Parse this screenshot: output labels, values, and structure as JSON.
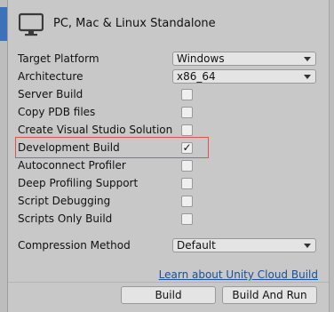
{
  "header": {
    "title": "PC, Mac & Linux Standalone",
    "icon": "monitor-icon"
  },
  "settings": {
    "target_platform": {
      "label": "Target Platform",
      "value": "Windows"
    },
    "architecture": {
      "label": "Architecture",
      "value": "x86_64"
    },
    "server_build": {
      "label": "Server Build",
      "checked": false
    },
    "copy_pdb": {
      "label": "Copy PDB files",
      "checked": false
    },
    "create_vs_solution": {
      "label": "Create Visual Studio Solution",
      "checked": false
    },
    "development_build": {
      "label": "Development Build",
      "checked": true,
      "check_glyph": "✓"
    },
    "autoconnect_profiler": {
      "label": "Autoconnect Profiler",
      "checked": false
    },
    "deep_profiling": {
      "label": "Deep Profiling Support",
      "checked": false
    },
    "script_debugging": {
      "label": "Script Debugging",
      "checked": false
    },
    "scripts_only": {
      "label": "Scripts Only Build",
      "checked": false
    },
    "compression_method": {
      "label": "Compression Method",
      "value": "Default"
    }
  },
  "link": {
    "text": "Learn about Unity Cloud Build"
  },
  "buttons": {
    "build": "Build",
    "build_and_run": "Build And Run"
  },
  "colors": {
    "highlight": "#e35050",
    "link": "#1a4f99",
    "panel": "#c8c8c8"
  }
}
